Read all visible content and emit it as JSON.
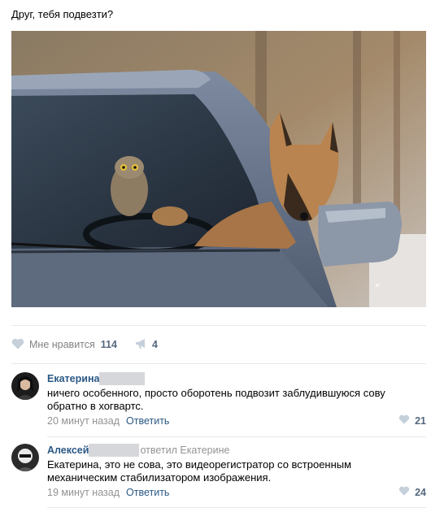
{
  "post": {
    "text": "Друг, тебя подвезти?",
    "image_alt": "photo-owl-and-dog-in-car"
  },
  "actions": {
    "like_label": "Мне нравится",
    "like_count": "114",
    "share_count": "4",
    "icons": {
      "like": "heart-icon",
      "share": "megaphone-icon"
    }
  },
  "comments": [
    {
      "author": "Екатерина",
      "reply_to": "",
      "text_lines": [
        "ничего особенного, просто оборотень подвозит заблудившуюся сову",
        "обратно в хогвартс."
      ],
      "time": "20 минут назад",
      "reply_label": "Ответить",
      "likes": "21"
    },
    {
      "author": "Алексей",
      "reply_to": "ответил Екатерине",
      "text_lines": [
        "Екатерина, это не сова, это видеорегистратор со встроенным",
        "механическим стабилизатором изображения."
      ],
      "time": "19 минут назад",
      "reply_label": "Ответить",
      "likes": "24"
    }
  ],
  "colors": {
    "link": "#2a5885",
    "meta": "#939393",
    "count": "#55677d",
    "icon": "#c5d0db",
    "divider": "#e7e8ec"
  }
}
